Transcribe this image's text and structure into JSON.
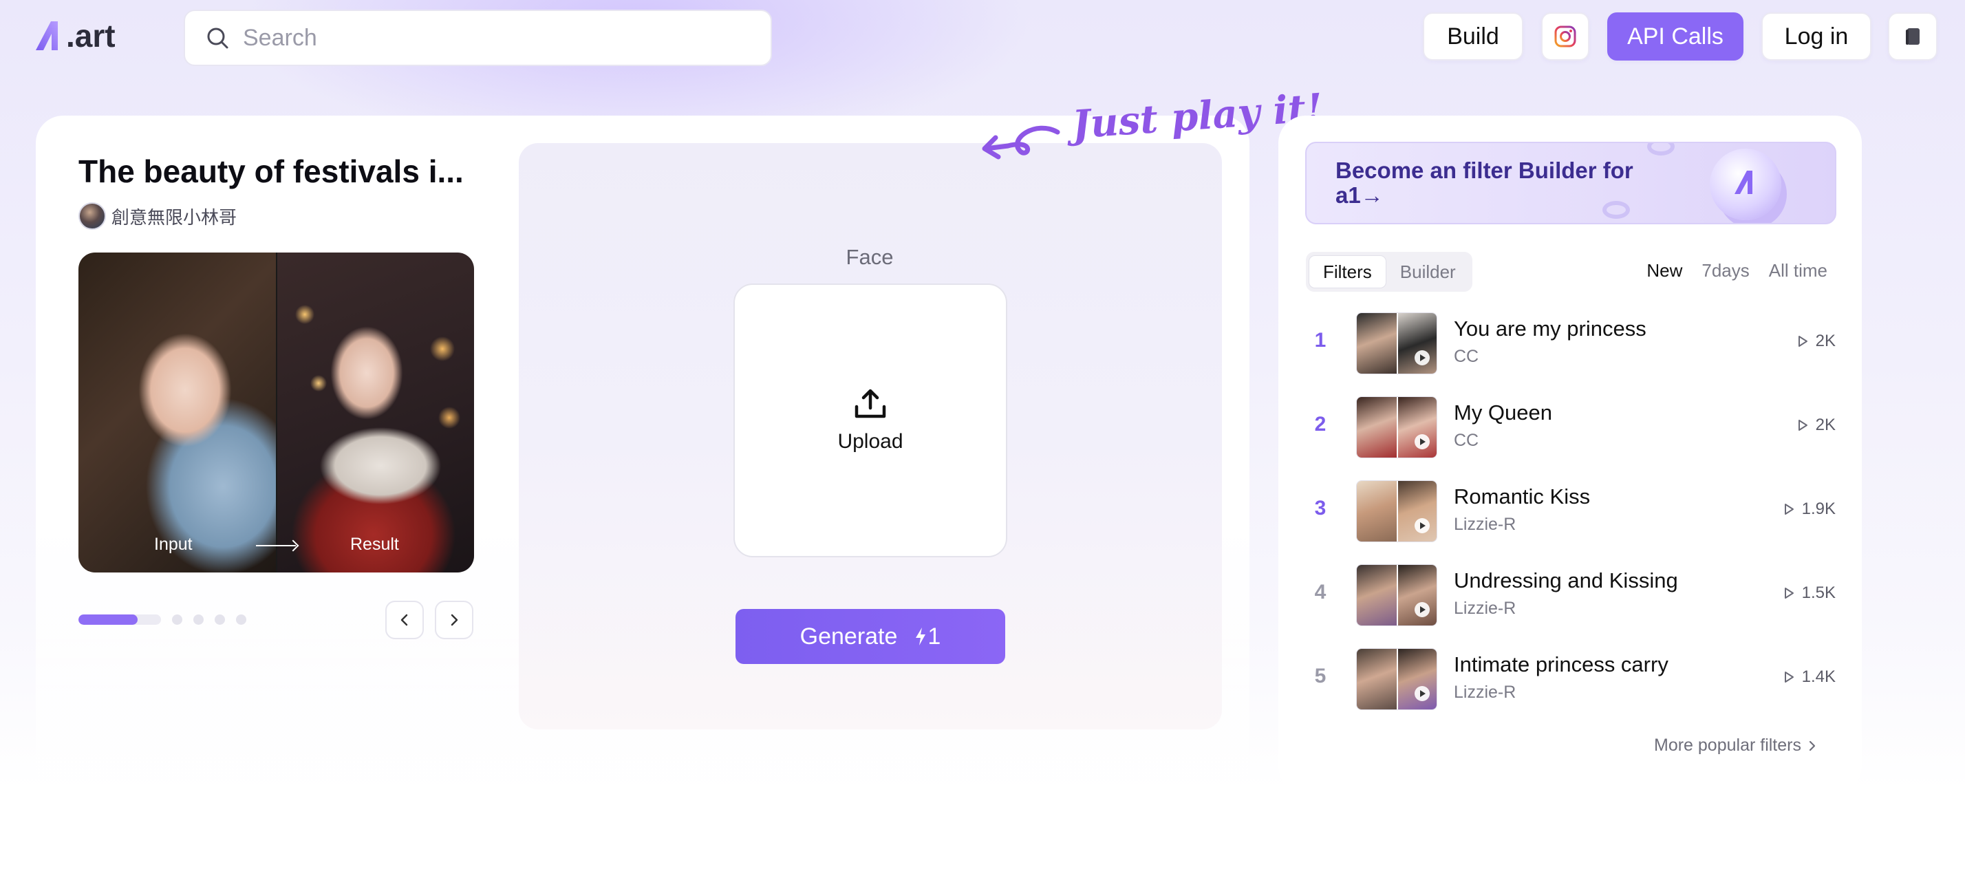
{
  "header": {
    "logo_text": ".art",
    "search_placeholder": "Search",
    "build_label": "Build",
    "instagram_icon": "instagram-icon",
    "api_label": "API Calls",
    "login_label": "Log in",
    "menu_icon": "book-icon"
  },
  "colors": {
    "accent": "#8a68f5",
    "rank_accent": "#7c5cec",
    "hint": "#8e56e6",
    "banner_text": "#3c2d90"
  },
  "filter": {
    "title": "The beauty of festivals i...",
    "author": "創意無限小林哥",
    "preview_input_label": "Input",
    "preview_result_label": "Result",
    "carousel_progress": 0.72
  },
  "play": {
    "hint": "Just play it!",
    "face_label": "Face",
    "upload_label": "Upload",
    "generate_label": "Generate",
    "generate_cost": "1"
  },
  "sidebar": {
    "banner_text": "Become an filter Builder for a1→",
    "tabs": [
      {
        "label": "Filters",
        "active": true
      },
      {
        "label": "Builder",
        "active": false
      }
    ],
    "ranges": [
      {
        "label": "New",
        "active": true
      },
      {
        "label": "7days",
        "active": false
      },
      {
        "label": "All time",
        "active": false
      }
    ],
    "ranking": [
      {
        "rank": "1",
        "title": "You are my princess",
        "author": "CC",
        "count": "2K"
      },
      {
        "rank": "2",
        "title": "My Queen",
        "author": "CC",
        "count": "2K"
      },
      {
        "rank": "3",
        "title": "Romantic Kiss",
        "author": "Lizzie-R",
        "count": "1.9K"
      },
      {
        "rank": "4",
        "title": "Undressing and Kissing",
        "author": "Lizzie-R",
        "count": "1.5K"
      },
      {
        "rank": "5",
        "title": "Intimate princess carry",
        "author": "Lizzie-R",
        "count": "1.4K"
      }
    ],
    "more_label": "More popular filters"
  }
}
